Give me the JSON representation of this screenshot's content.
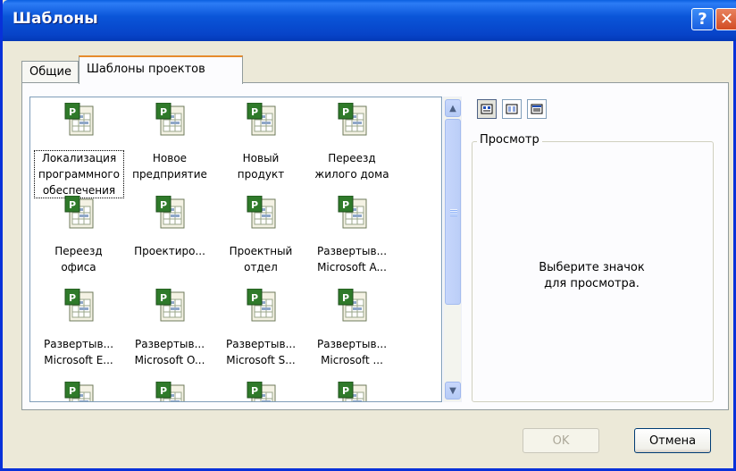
{
  "window": {
    "title": "Шаблоны",
    "help_label": "?",
    "close_label": "✕"
  },
  "tabs": [
    {
      "label": "Общие",
      "active": false
    },
    {
      "label": "Шаблоны проектов",
      "active": true
    }
  ],
  "templates": [
    {
      "label": "Локализация\nпрограммного\nобеспечения",
      "icon": "project-template-icon",
      "selected": true
    },
    {
      "label": "Новое\nпредприятие",
      "icon": "project-template-icon"
    },
    {
      "label": "Новый\nпродукт",
      "icon": "project-template-icon"
    },
    {
      "label": "Переезд\nжилого дома",
      "icon": "project-template-icon"
    },
    {
      "label": "Переезд\nофиса",
      "icon": "project-template-icon"
    },
    {
      "label": "Проектиро...",
      "icon": "project-template-icon"
    },
    {
      "label": "Проектный\nотдел",
      "icon": "project-template-icon"
    },
    {
      "label": "Развертыв...\nMicrosoft A...",
      "icon": "project-template-icon"
    },
    {
      "label": "Развертыв...\nMicrosoft E...",
      "icon": "project-template-icon"
    },
    {
      "label": "Развертыв...\nMicrosoft O...",
      "icon": "project-template-icon"
    },
    {
      "label": "Развертыв...\nMicrosoft S...",
      "icon": "project-template-icon"
    },
    {
      "label": "Развертыв...\nMicrosoft ...",
      "icon": "project-template-icon"
    },
    {
      "label": "",
      "icon": "project-template-icon"
    },
    {
      "label": "",
      "icon": "project-template-icon"
    },
    {
      "label": "",
      "icon": "project-template-icon"
    },
    {
      "label": "",
      "icon": "project-template-icon"
    }
  ],
  "view_buttons": [
    {
      "icon": "large-icons-view-icon",
      "active": true
    },
    {
      "icon": "list-view-icon",
      "active": false
    },
    {
      "icon": "details-view-icon",
      "active": false
    }
  ],
  "preview": {
    "legend": "Просмотр",
    "message": "Выберите значок\nдля просмотра."
  },
  "buttons": {
    "ok": "OK",
    "cancel": "Отмена"
  },
  "colors": {
    "titlebar": "#0A55D8",
    "face": "#ECE9D8",
    "tab_highlight": "#E68B2C"
  }
}
